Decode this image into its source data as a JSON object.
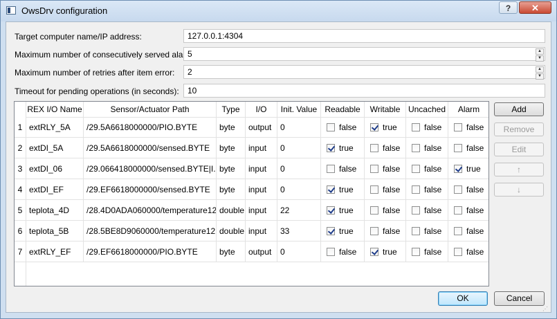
{
  "window": {
    "title": "OwsDrv configuration",
    "help_label": "?",
    "close_label": "✕"
  },
  "form": {
    "target_label": "Target computer name/IP address:",
    "target_value": "127.0.0.1:4304",
    "max_alarms_label": "Maximum number of consecutively served alarms:",
    "max_alarms_value": "5",
    "max_retries_label": "Maximum number of retries after item error:",
    "max_retries_value": "2",
    "timeout_label": "Timeout for pending operations (in seconds):",
    "timeout_value": "10"
  },
  "table": {
    "columns": [
      "REX I/O Name",
      "Sensor/Actuator Path",
      "Type",
      "I/O",
      "Init. Value",
      "Readable",
      "Writable",
      "Uncached",
      "Alarm"
    ],
    "rows": [
      {
        "num": "1",
        "name": "extRLY_5A",
        "path": "/29.5A6618000000/PIO.BYTE",
        "type": "byte",
        "io": "output",
        "init": "0",
        "readable": false,
        "readable_label": "false",
        "writable": true,
        "writable_label": "true",
        "uncached": false,
        "uncached_label": "false",
        "alarm": false,
        "alarm_label": "false"
      },
      {
        "num": "2",
        "name": "extDI_5A",
        "path": "/29.5A6618000000/sensed.BYTE",
        "type": "byte",
        "io": "input",
        "init": "0",
        "readable": true,
        "readable_label": "true",
        "writable": false,
        "writable_label": "false",
        "uncached": false,
        "uncached_label": "false",
        "alarm": false,
        "alarm_label": "false"
      },
      {
        "num": "3",
        "name": "extDI_06",
        "path": "/29.066418000000/sensed.BYTE|I...",
        "type": "byte",
        "io": "input",
        "init": "0",
        "readable": false,
        "readable_label": "false",
        "writable": false,
        "writable_label": "false",
        "uncached": false,
        "uncached_label": "false",
        "alarm": true,
        "alarm_label": "true"
      },
      {
        "num": "4",
        "name": "extDI_EF",
        "path": "/29.EF6618000000/sensed.BYTE",
        "type": "byte",
        "io": "input",
        "init": "0",
        "readable": true,
        "readable_label": "true",
        "writable": false,
        "writable_label": "false",
        "uncached": false,
        "uncached_label": "false",
        "alarm": false,
        "alarm_label": "false"
      },
      {
        "num": "5",
        "name": "teplota_4D",
        "path": "/28.4D0ADA060000/temperature12",
        "type": "double",
        "io": "input",
        "init": "22",
        "readable": true,
        "readable_label": "true",
        "writable": false,
        "writable_label": "false",
        "uncached": false,
        "uncached_label": "false",
        "alarm": false,
        "alarm_label": "false"
      },
      {
        "num": "6",
        "name": "teplota_5B",
        "path": "/28.5BE8D9060000/temperature12",
        "type": "double",
        "io": "input",
        "init": "33",
        "readable": true,
        "readable_label": "true",
        "writable": false,
        "writable_label": "false",
        "uncached": false,
        "uncached_label": "false",
        "alarm": false,
        "alarm_label": "false"
      },
      {
        "num": "7",
        "name": "extRLY_EF",
        "path": "/29.EF6618000000/PIO.BYTE",
        "type": "byte",
        "io": "output",
        "init": "0",
        "readable": false,
        "readable_label": "false",
        "writable": true,
        "writable_label": "true",
        "uncached": false,
        "uncached_label": "false",
        "alarm": false,
        "alarm_label": "false"
      }
    ]
  },
  "side_buttons": {
    "add": "Add",
    "remove": "Remove",
    "edit": "Edit",
    "up": "↑",
    "down": "↓"
  },
  "footer": {
    "ok": "OK",
    "cancel": "Cancel"
  },
  "icons": {
    "spin_up": "▲",
    "spin_down": "▼",
    "grip": "⋰"
  }
}
